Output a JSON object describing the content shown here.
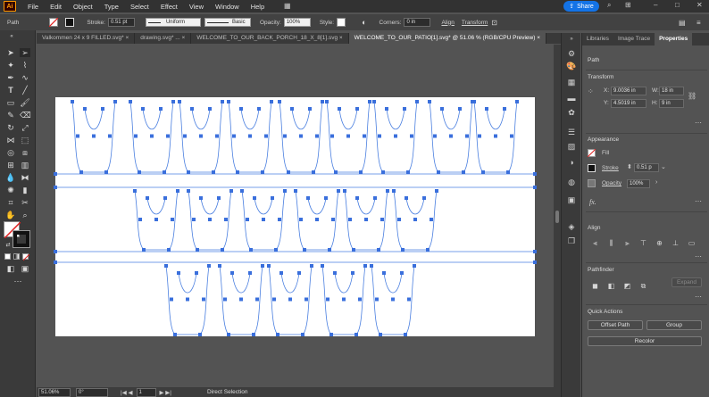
{
  "app": {
    "logo": "Ai"
  },
  "menu": [
    "File",
    "Edit",
    "Object",
    "Type",
    "Select",
    "Effect",
    "View",
    "Window",
    "Help"
  ],
  "share": {
    "label": "Share",
    "icon": "share-icon"
  },
  "control": {
    "selection_type": "Path",
    "stroke_label": "Stroke:",
    "stroke_value": "0.51 pt",
    "profile_label": "Uniform",
    "brush_label": "Basic",
    "opacity_label": "Opacity:",
    "opacity_value": "100%",
    "style_label": "Style:",
    "corners_label": "Corners:",
    "corners_value": "0 in",
    "align_label": "Align",
    "transform_label": "Transform"
  },
  "tabs": [
    {
      "label": "Valkommen 24 x 9 FILLED.svg*",
      "close": "×"
    },
    {
      "label": "drawing.svg* ...",
      "close": "×"
    },
    {
      "label": "WELCOME_TO_OUR_BACK_PORCH_18_X_8[1].svg",
      "close": "×"
    },
    {
      "label": "WELCOME_TO_OUR_PATIO[1].svg* @ 51.06 % (RGB/CPU Preview)",
      "close": "×"
    }
  ],
  "status": {
    "zoom": "51.06%",
    "rotation": "0°",
    "page": "1",
    "tool": "Direct Selection"
  },
  "panel": {
    "tabs": [
      "Libraries",
      "Image Trace",
      "Properties"
    ],
    "path_label": "Path",
    "transform_title": "Transform",
    "x_label": "X:",
    "x_value": "9.0036 in",
    "y_label": "Y:",
    "y_value": "4.5019 in",
    "w_label": "W:",
    "w_value": "18 in",
    "h_label": "H:",
    "h_value": "9 in",
    "appearance_title": "Appearance",
    "fill_label": "Fill",
    "stroke_label": "Stroke",
    "stroke_value": "0.51 p",
    "opacity_label": "Opacity",
    "opacity_value": "100%",
    "fx_label": "fx.",
    "align_title": "Align",
    "pathfinder_title": "Pathfinder",
    "expand_label": "Expand",
    "quick_actions_title": "Quick Actions",
    "offset_path_label": "Offset Path",
    "group_label": "Group",
    "recolor_label": "Recolor"
  },
  "colors": {
    "accent": "#1473e6",
    "path": "#4a7fe0",
    "anchor": "#3a6fdc"
  }
}
